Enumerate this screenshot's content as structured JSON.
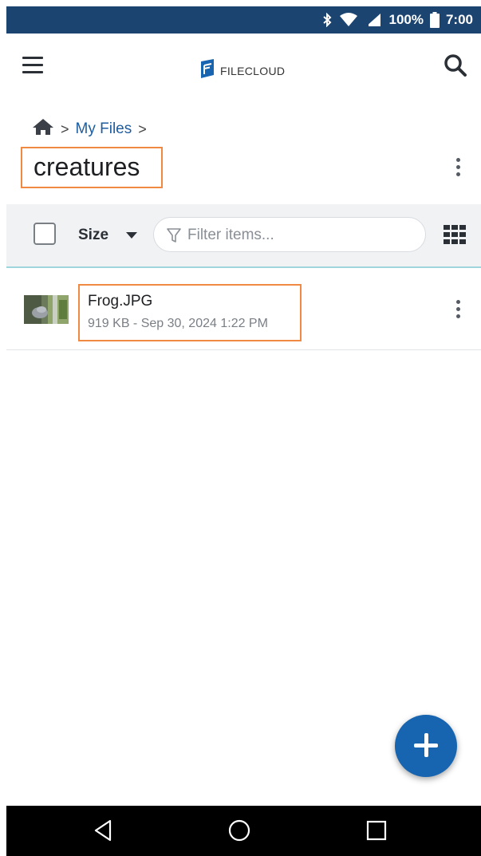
{
  "status_bar": {
    "battery_percent": "100%",
    "time": "7:00",
    "icons": [
      "bluetooth-icon",
      "wifi-icon",
      "signal-icon",
      "battery-icon"
    ]
  },
  "app_bar": {
    "logo_text_bold": "FILE",
    "logo_text_light": "CLOUD",
    "icons": [
      "menu-icon",
      "search-icon"
    ]
  },
  "breadcrumb": {
    "items": [
      "My Files"
    ],
    "separator": ">",
    "home_icon": "home-icon"
  },
  "folder": {
    "title": "creatures"
  },
  "toolbar": {
    "sort_label": "Size",
    "filter_placeholder": "Filter items...",
    "icons": [
      "checkbox-icon",
      "caret-down-icon",
      "filter-icon",
      "grid-view-icon"
    ]
  },
  "files": [
    {
      "name": "Frog.JPG",
      "meta": "919 KB - Sep 30, 2024 1:22 PM",
      "thumbnail_icon": "image-thumbnail"
    }
  ],
  "fab": {
    "icon": "plus-icon"
  },
  "nav_bar": {
    "icons": [
      "back-icon",
      "home-circle-icon",
      "recents-icon"
    ]
  },
  "colors": {
    "status_bar_bg": "#1c4470",
    "accent_blue": "#1765b0",
    "link_blue": "#1d5da0",
    "highlight_orange": "#f08a43",
    "toolbar_bg": "#f1f2f4"
  }
}
